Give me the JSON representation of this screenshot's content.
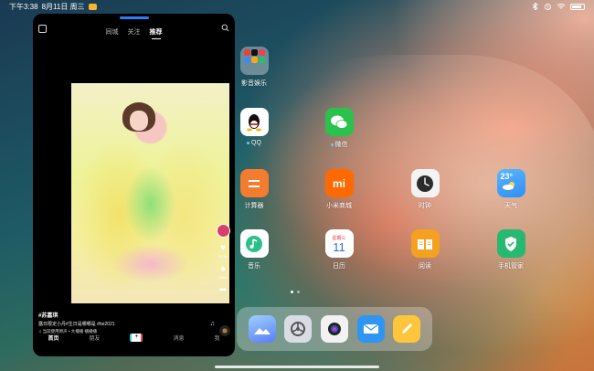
{
  "status_bar": {
    "time": "下午3:38",
    "date": "8月11日 周三"
  },
  "floating_window": {
    "tabs": [
      "同城",
      "关注",
      "推荐"
    ],
    "active_tab": "推荐",
    "video": {
      "user": "#苏嘉琪",
      "caption": "露日限定小丹#生日是哪哪是 #be2021",
      "music": "♫ 当前使用原声 • 大播播 播播播",
      "like_count": "10.3w",
      "comment_count": "2584"
    },
    "bottom_nav": {
      "home": "首页",
      "friends": "朋友",
      "plus": "+",
      "messages": "消息",
      "me": "我"
    }
  },
  "home_screen": {
    "apps": [
      {
        "label": "影音娱乐",
        "icon": "folder-icon"
      },
      {
        "label": "QQ",
        "icon": "qq-icon"
      },
      {
        "label": "微信",
        "icon": "wechat-icon"
      },
      {
        "label": "计算器",
        "icon": "calculator-icon"
      },
      {
        "label": "小米商城",
        "icon": "mi-store-icon"
      },
      {
        "label": "时钟",
        "icon": "clock-icon"
      },
      {
        "label": "天气",
        "icon": "weather-icon"
      },
      {
        "label": "音乐",
        "icon": "music-icon"
      },
      {
        "label": "日历",
        "icon": "calendar-icon"
      },
      {
        "label": "阅读",
        "icon": "book-icon"
      },
      {
        "label": "手机管家",
        "icon": "security-icon"
      }
    ],
    "weather_temp": "23°",
    "calendar": {
      "weekday": "星期三",
      "day": "11"
    },
    "mi_logo": "mi"
  },
  "dock": [
    "gallery-icon",
    "settings-icon",
    "camera-icon",
    "mail-icon",
    "notes-icon"
  ],
  "colors": {
    "calculator": "#f47c30",
    "mi_store": "#ff6a00",
    "wechat": "#2ac14c",
    "weather": "#3ba3ff",
    "music": "#2bbf8a",
    "book": "#f4a020",
    "security": "#27b871"
  }
}
